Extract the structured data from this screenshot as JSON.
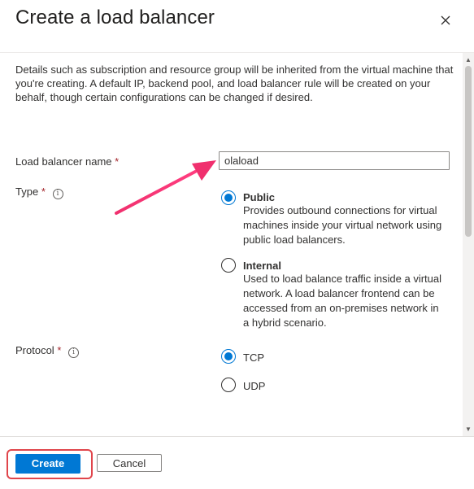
{
  "header": {
    "title": "Create a load balancer",
    "close_icon": "close-icon"
  },
  "body": {
    "description": "Details such as subscription and resource group will be inherited from the virtual machine that you're creating. A default IP, backend pool, and load balancer rule will be created on your behalf, though certain configurations can be changed if desired.",
    "name_field": {
      "label": "Load balancer name",
      "required_marker": "*",
      "value": "olaload"
    },
    "type_field": {
      "label": "Type",
      "required_marker": "*",
      "info_icon": "info-icon",
      "options": [
        {
          "label": "Public",
          "description": "Provides outbound connections for virtual machines inside your virtual network using public load balancers.",
          "selected": true
        },
        {
          "label": "Internal",
          "description": "Used to load balance traffic inside a virtual network. A load balancer frontend can be accessed from an on-premises network in a hybrid scenario.",
          "selected": false
        }
      ]
    },
    "protocol_field": {
      "label": "Protocol",
      "required_marker": "*",
      "info_icon": "info-icon",
      "options": [
        {
          "label": "TCP",
          "selected": true
        },
        {
          "label": "UDP",
          "selected": false
        }
      ]
    }
  },
  "footer": {
    "create_label": "Create",
    "cancel_label": "Cancel"
  },
  "colors": {
    "accent": "#0078d4",
    "required": "#a4262c",
    "annotation": "#f0306e",
    "highlight": "#e0454b"
  }
}
